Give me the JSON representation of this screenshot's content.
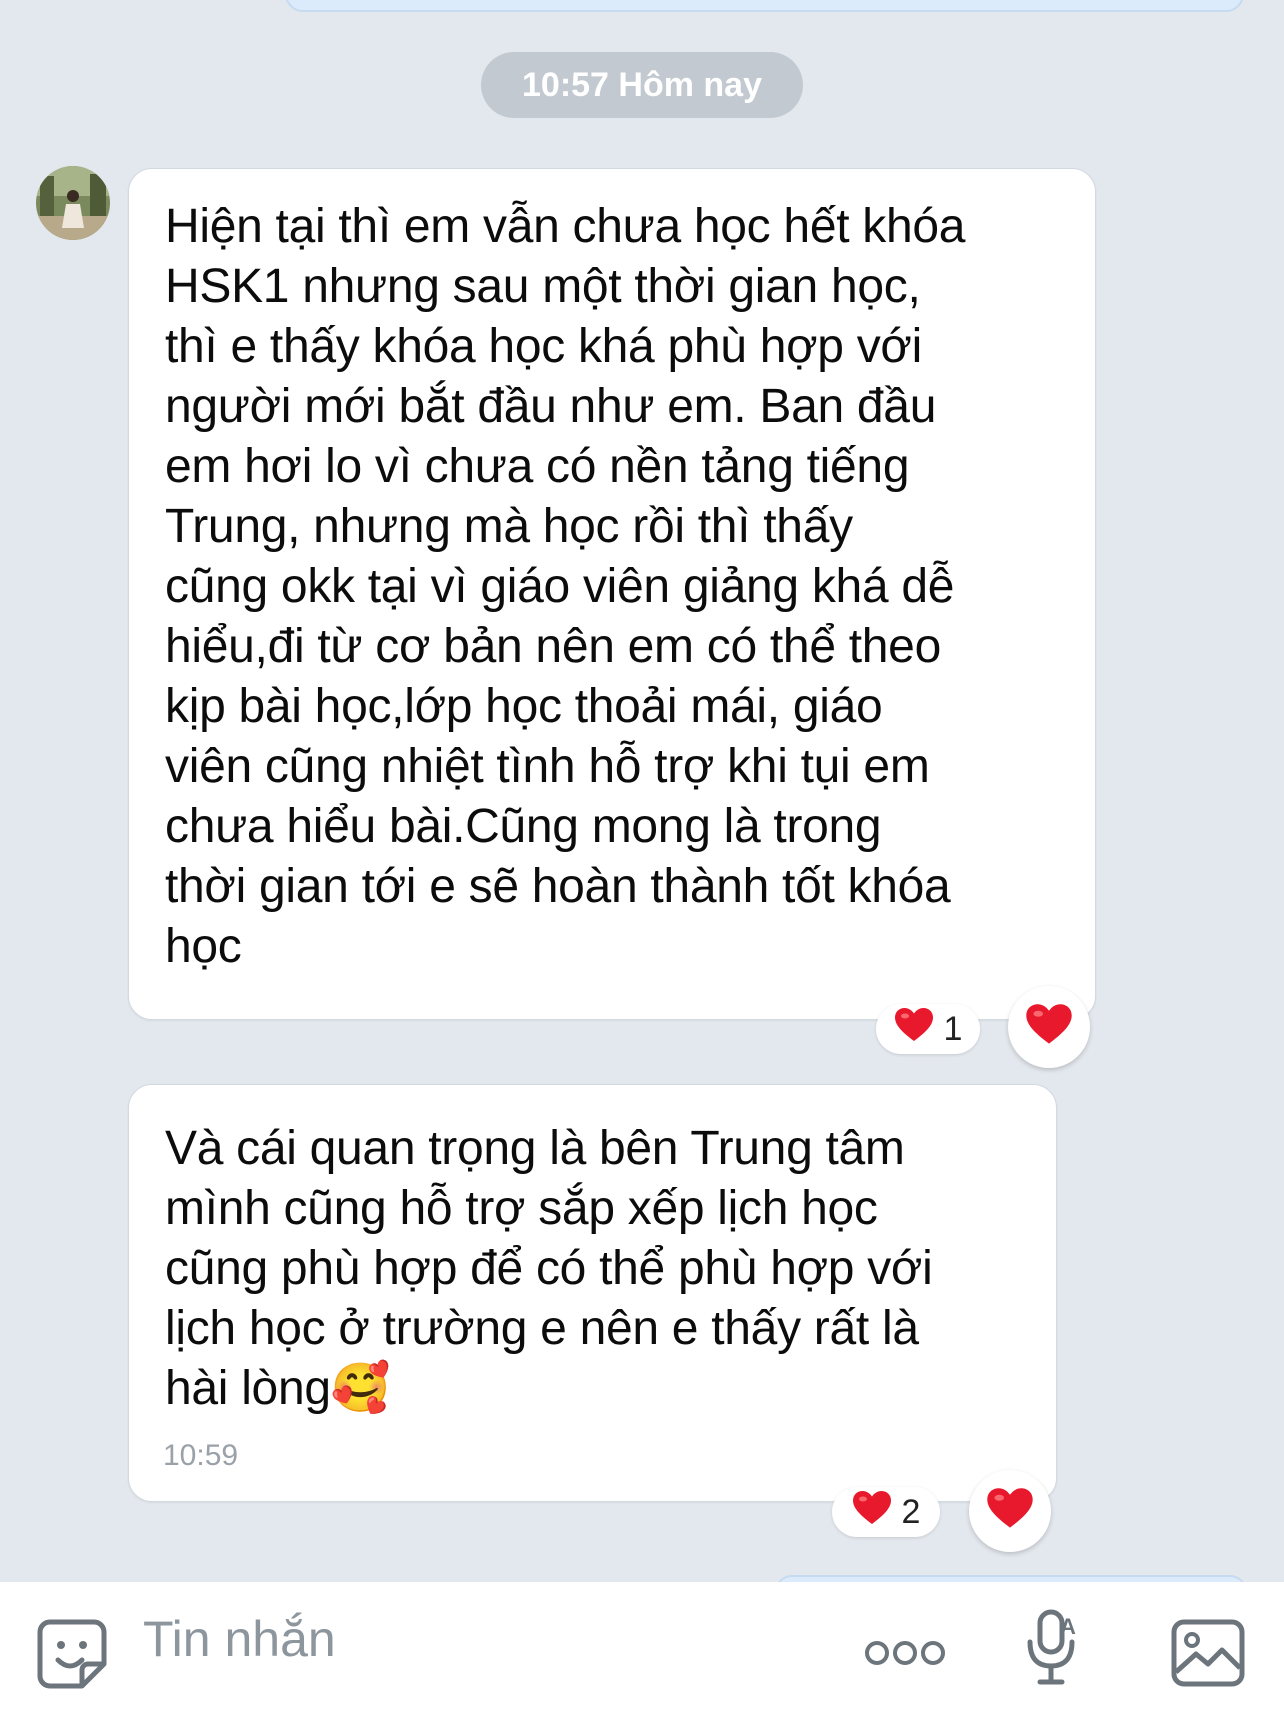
{
  "time_separator": "10:57 Hôm nay",
  "messages": [
    {
      "text": "Hiện tại thì em vẫn chưa học hết khóa\nHSK1 nhưng sau một thời gian học,\nthì e thấy khóa học khá phù hợp với\nngười mới bắt đầu như em. Ban đầu\nem hơi lo vì chưa có nền tảng tiếng\nTrung, nhưng mà học rồi thì thấy\ncũng okk tại vì giáo viên giảng khá dễ\nhiểu,đi từ cơ bản nên em có thể theo\nkịp bài học,lớp học thoải mái, giáo\nviên cũng nhiệt tình hỗ trợ khi tụi em\nchưa hiểu bài.Cũng mong là trong\nthời gian tới e sẽ hoàn thành tốt khóa\nhọc",
      "reaction_count": "1"
    },
    {
      "text": "Và cái quan trọng là bên Trung tâm\nmình cũng hỗ trợ sắp xếp lịch học\ncũng phù hợp để có thể phù hợp với\nlịch học ở trường e nên e thấy rất là\nhài lòng🥰",
      "time": "10:59",
      "reaction_count": "2"
    }
  ],
  "input": {
    "placeholder": "Tin nhắn"
  },
  "colors": {
    "background": "#e3e8ee",
    "heart": "#e8192c",
    "bubble": "#ffffff"
  }
}
